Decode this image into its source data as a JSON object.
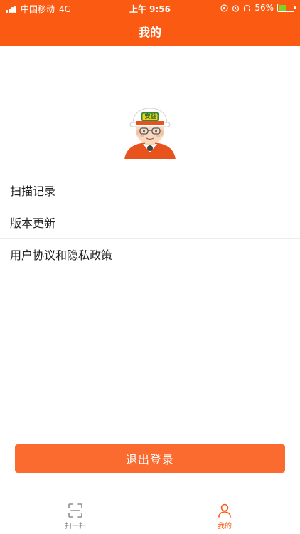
{
  "status_bar": {
    "carrier": "中国移动",
    "network": "4G",
    "time": "上午 9:56",
    "battery": "56%",
    "battery_level": 0.56
  },
  "header": {
    "title": "我的"
  },
  "avatar": {
    "badge_text": "安益",
    "icon": "safety-helmet-avatar"
  },
  "menu": {
    "items": [
      {
        "label": "扫描记录"
      },
      {
        "label": "版本更新"
      },
      {
        "label": "用户协议和隐私政策"
      }
    ]
  },
  "logout": {
    "label": "退出登录"
  },
  "tabbar": {
    "tabs": [
      {
        "label": "扫一扫",
        "icon": "scan-icon",
        "active": false
      },
      {
        "label": "我的",
        "icon": "person-icon",
        "active": true
      }
    ]
  },
  "colors": {
    "brand": "#fb5a12",
    "button": "#fb6a2e",
    "inactive": "#8e8e8e",
    "battery": "#7ed321"
  }
}
